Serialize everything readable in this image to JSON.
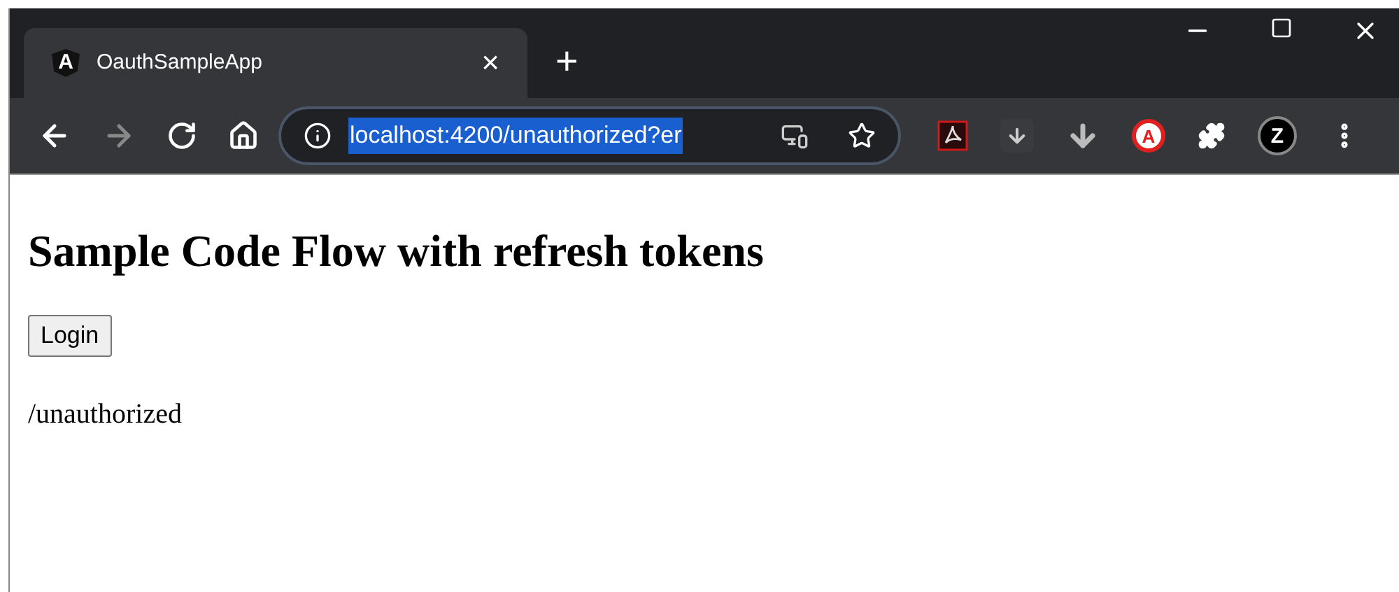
{
  "tab": {
    "icon_letter": "A",
    "title": "OauthSampleApp",
    "close": "×",
    "new_tab": "+"
  },
  "address": {
    "url": "localhost:4200/unauthorized?er",
    "selected": true
  },
  "extensions": [
    {
      "kind": "pdf"
    },
    {
      "kind": "download-box"
    },
    {
      "kind": "download"
    },
    {
      "kind": "letter",
      "letter": "A"
    },
    {
      "kind": "puzzle"
    },
    {
      "kind": "letter-dark",
      "letter": "Z"
    }
  ],
  "page": {
    "heading": "Sample Code Flow with refresh tokens",
    "button": "Login",
    "route": "/unauthorized"
  }
}
